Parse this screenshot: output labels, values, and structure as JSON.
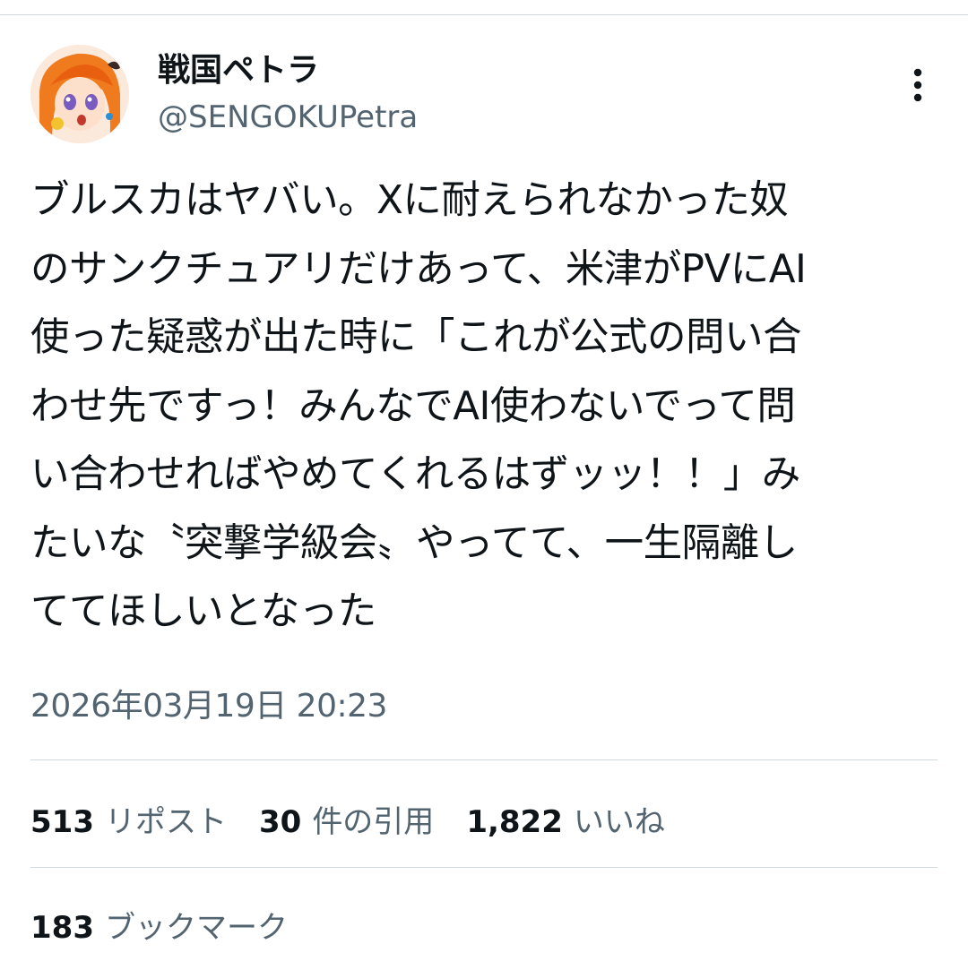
{
  "author": {
    "display_name": "戦国ペトラ",
    "handle": "@SENGOKUPetra"
  },
  "tweet": {
    "lines": [
      "ブルスカはヤバい。Xに耐えられなかった奴",
      "のサンクチュアリだけあって、米津がPVにAI",
      "使った疑惑が出た時に「これが公式の問い合",
      "わせ先ですっ！みんなでAI使わないでって問",
      "い合わせればやめてくれるはずッッ！！」み",
      "たいな〝突撃学級会〟やってて、一生隔離し",
      "ててほしいとなった"
    ],
    "timestamp": "2026年03月19日 20:23"
  },
  "stats": {
    "reposts": {
      "count": "513",
      "label": "リポスト"
    },
    "quotes": {
      "count": "30",
      "label": "件の引用"
    },
    "likes": {
      "count": "1,822",
      "label": "いいね"
    },
    "bookmarks": {
      "count": "183",
      "label": "ブックマーク"
    }
  },
  "icons": {
    "more": "more-vertical-icon",
    "avatar": "avatar-image"
  },
  "colors": {
    "text": "#0f1419",
    "secondary": "#536471",
    "divider": "#cfd9de"
  }
}
